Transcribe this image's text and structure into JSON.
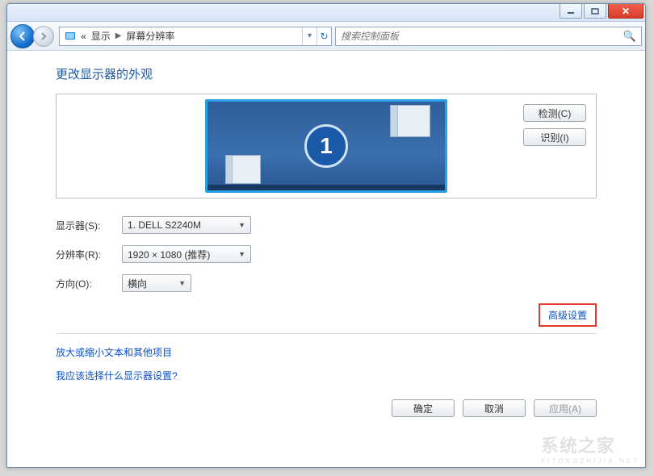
{
  "titlebar": {
    "min_tooltip": "最小化",
    "max_tooltip": "最大化",
    "close_tooltip": "关闭"
  },
  "breadcrumb": {
    "root_prefix": "«",
    "level1": "显示",
    "level2": "屏幕分辨率"
  },
  "search": {
    "placeholder": "搜索控制面板"
  },
  "heading": "更改显示器的外观",
  "preview": {
    "monitor_number": "1"
  },
  "side_buttons": {
    "detect": "检测(C)",
    "identify": "识别(I)"
  },
  "form": {
    "display_label": "显示器(S):",
    "display_value": "1. DELL S2240M",
    "resolution_label": "分辨率(R):",
    "resolution_value": "1920 × 1080 (推荐)",
    "orientation_label": "方向(O):",
    "orientation_value": "横向"
  },
  "links": {
    "advanced": "高级设置",
    "text_scaling": "放大或缩小文本和其他项目",
    "which_settings": "我应该选择什么显示器设置?"
  },
  "footer": {
    "ok": "确定",
    "cancel": "取消",
    "apply": "应用(A)"
  },
  "watermark": {
    "main": "系统之家",
    "sub": "XITONGZHIJIA.NET"
  }
}
